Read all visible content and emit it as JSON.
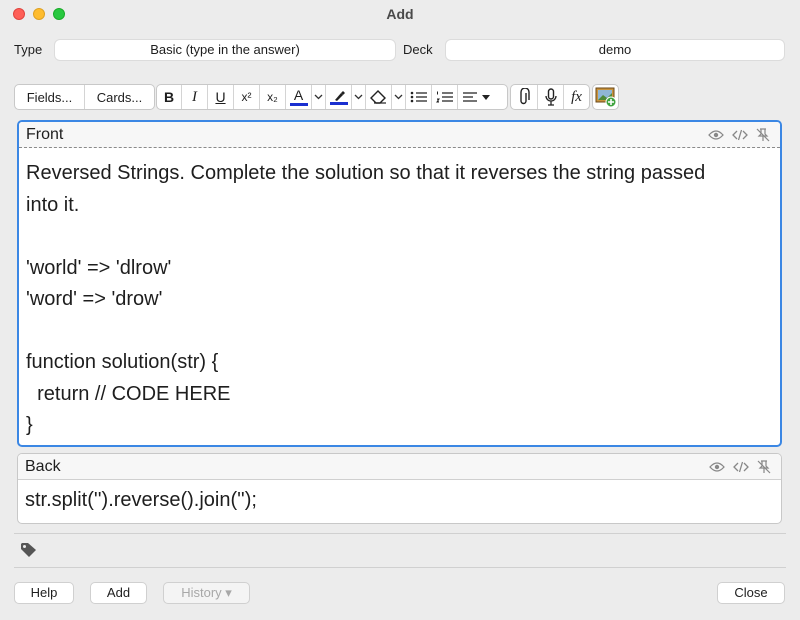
{
  "window": {
    "title": "Add"
  },
  "note_type": {
    "label": "Type",
    "value": "Basic (type in the answer)"
  },
  "deck": {
    "label": "Deck",
    "value": "demo"
  },
  "toolbar": {
    "fields_label": "Fields...",
    "cards_label": "Cards...",
    "bold": "B",
    "italic": "I",
    "underline": "U",
    "superscript": "x²",
    "subscript": "x₂",
    "text_color_glyph": "A",
    "text_color": "#1a2fd0",
    "highlight_color": "#1a2fd0",
    "mathjax_glyph": "fx"
  },
  "front": {
    "label": "Front",
    "lines": [
      "Reversed Strings. Complete the solution so that it reverses the string passed",
      "into it.",
      "",
      "'world' => 'dlrow'",
      "'word' => 'drow'",
      "",
      "function solution(str) {",
      "  return // CODE HERE",
      "}"
    ]
  },
  "back": {
    "label": "Back",
    "lines": [
      "str.split('').reverse().join('');"
    ]
  },
  "buttons": {
    "help": "Help",
    "add": "Add",
    "history": "History ▾",
    "close": "Close"
  },
  "icons": {
    "eye": "eye-icon",
    "html": "html-editor-icon",
    "pin": "pin-icon",
    "tag": "tag-icon"
  }
}
